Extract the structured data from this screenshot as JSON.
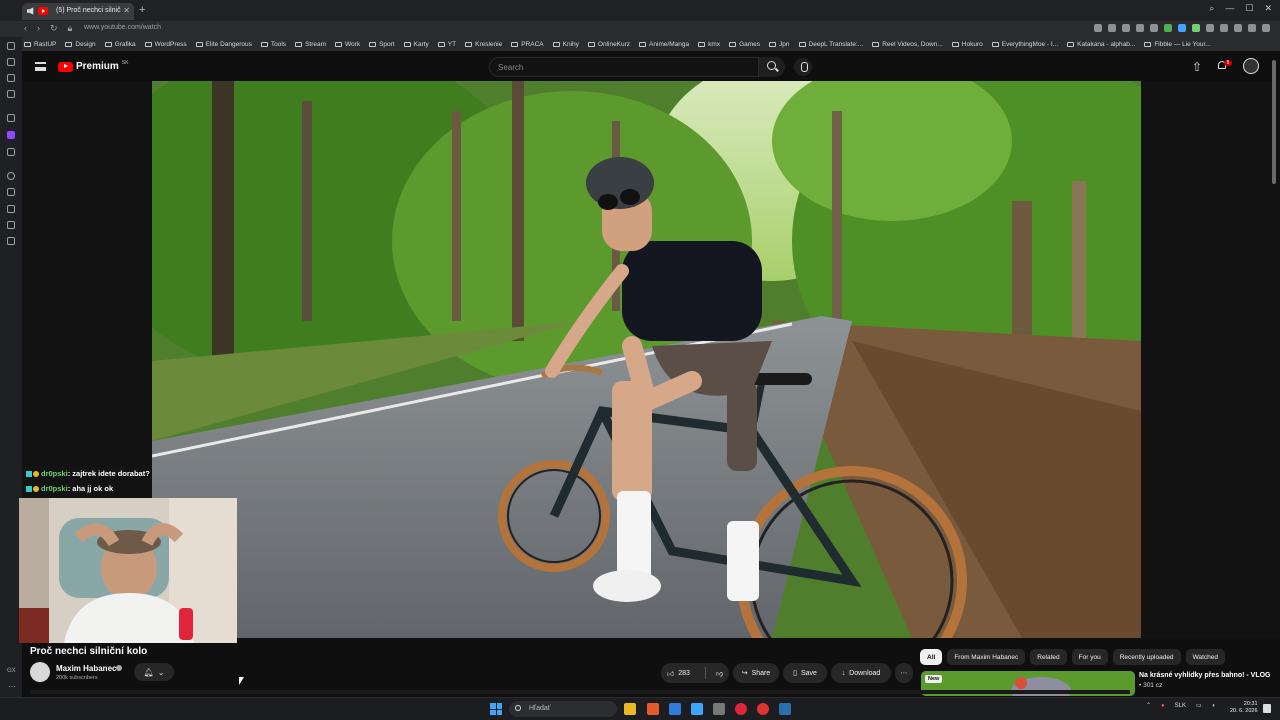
{
  "browser": {
    "tab_title": "(5) Proč nechci silnič",
    "url": "www.youtube.com/watch",
    "bookmarks": [
      "RastUP",
      "Design",
      "Grafika",
      "WordPress",
      "Elite Dangerous",
      "Tools",
      "Stream",
      "Work",
      "Sport",
      "Karty",
      "YT",
      "Kreslenie",
      "PRACA",
      "Knihy",
      "OnlineKurz",
      "Anime/Manga",
      "kmx",
      "Games",
      "Jpn",
      "DeepL Translate:...",
      "Reel Videos, Down...",
      "Hokuro",
      "EverythingMoe - I...",
      "Katakana - alphab...",
      "Fibble — Lie Your..."
    ]
  },
  "youtube": {
    "logo_text": "Premium",
    "logo_region": "SK",
    "search_placeholder": "Search",
    "notification_count": "5"
  },
  "chat": [
    {
      "user": "dr0pski",
      "message": "zajtrek idete dorabat?"
    },
    {
      "user": "dr0pski",
      "message": "aha jj ok ok"
    }
  ],
  "video": {
    "title": "Proč nechci silniční kolo",
    "channel": "Maxim Habanec",
    "subscribers": "200k subscribers",
    "likes": "283",
    "share_label": "Share",
    "save_label": "Save",
    "download_label": "Download"
  },
  "chips": [
    "All",
    "From Maxim Habanec",
    "Related",
    "For you",
    "Recently uploaded",
    "Watched"
  ],
  "recommendation": {
    "badge": "New",
    "title": "Na krásné vyhlídky přes bahno! - VLOG",
    "meta": "• 301 cz"
  },
  "left_label": "GX",
  "taskbar": {
    "search_placeholder": "Hľadať",
    "language": "SLK",
    "time": "20:31",
    "date": "20. 6. 2026"
  },
  "colors": {
    "youtube_red": "#ff0000",
    "chat_user": "#6fd26f",
    "chip_active": "#f1f1f1"
  }
}
